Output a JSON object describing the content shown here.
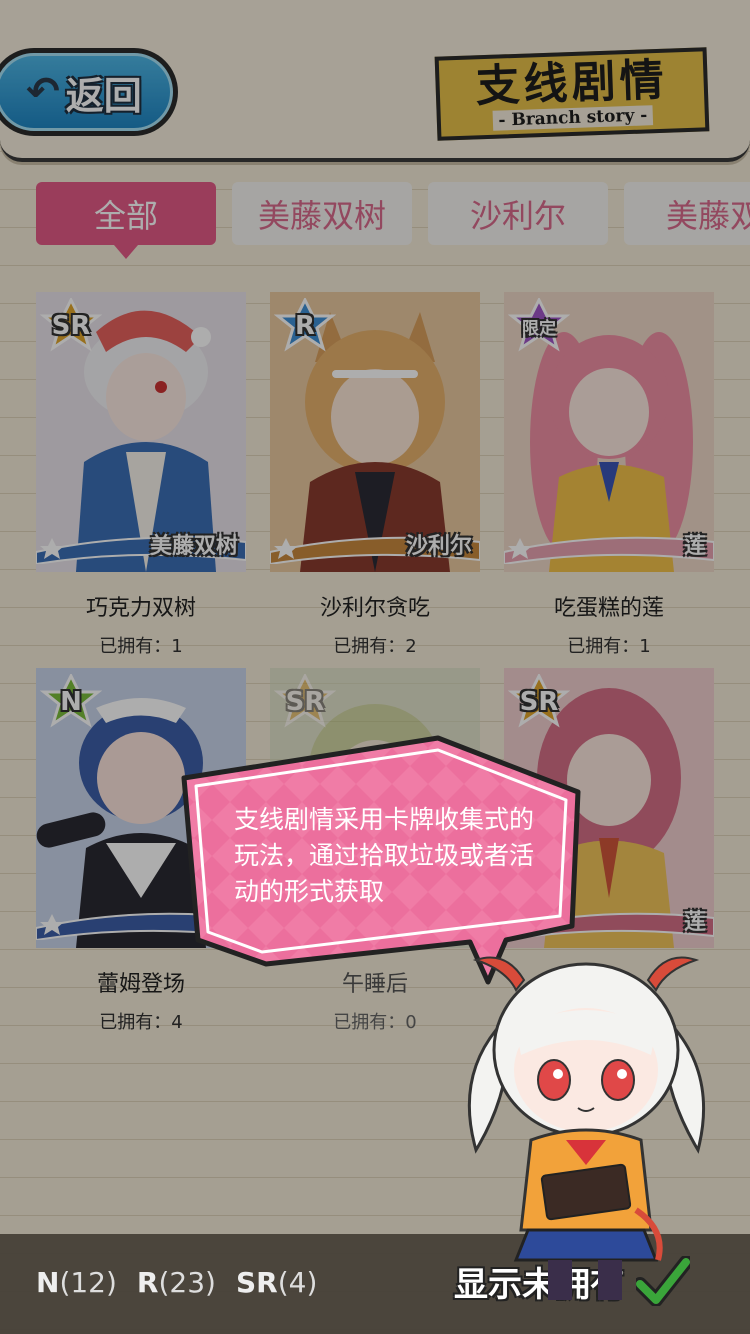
{
  "header": {
    "back_label": "返回",
    "title": "支线剧情",
    "subtitle": "- Branch story -"
  },
  "tabs": [
    {
      "label": "全部",
      "active": true
    },
    {
      "label": "美藤双树",
      "active": false
    },
    {
      "label": "沙利尔",
      "active": false
    },
    {
      "label": "美藤双",
      "active": false
    }
  ],
  "cards": [
    {
      "name": "巧克力双树",
      "count": "已拥有：1",
      "rarity": "SR",
      "ribbon": "美藤双树",
      "theme": "#3b6fb6"
    },
    {
      "name": "沙利尔贪吃",
      "count": "已拥有：2",
      "rarity": "R",
      "ribbon": "沙利尔",
      "theme": "#c98a3f"
    },
    {
      "name": "吃蛋糕的莲",
      "count": "已拥有：1",
      "rarity": "限定",
      "ribbon": "莲",
      "theme": "#e7a3b2"
    },
    {
      "name": "蕾姆登场",
      "count": "已拥有：4",
      "rarity": "N",
      "ribbon": "蕾",
      "theme": "#3d5fa8"
    },
    {
      "name": "午睡后",
      "count": "已拥有：0",
      "rarity": "SR",
      "ribbon": "",
      "theme": "#9fb27a"
    },
    {
      "name": "",
      "count": "",
      "rarity": "SR",
      "ribbon": "莲",
      "theme": "#d56f86"
    }
  ],
  "tooltip": {
    "text": "支线剧情采用卡牌收集式的玩法，通过拾取垃圾或者活动的形式获取"
  },
  "bottom_bar": {
    "n_label": "N",
    "n_count": "(12)",
    "r_label": "R",
    "r_count": "(23)",
    "sr_label": "SR",
    "sr_count": "(4)",
    "show_owned_label": "显示未拥有",
    "show_owned_checked": true
  },
  "colors": {
    "accent_pink": "#e35b87",
    "tab_text": "#d96a8c",
    "back_button": "#1f86c4",
    "title_gold": "#e7c24b",
    "check_green": "#3aa53a"
  }
}
